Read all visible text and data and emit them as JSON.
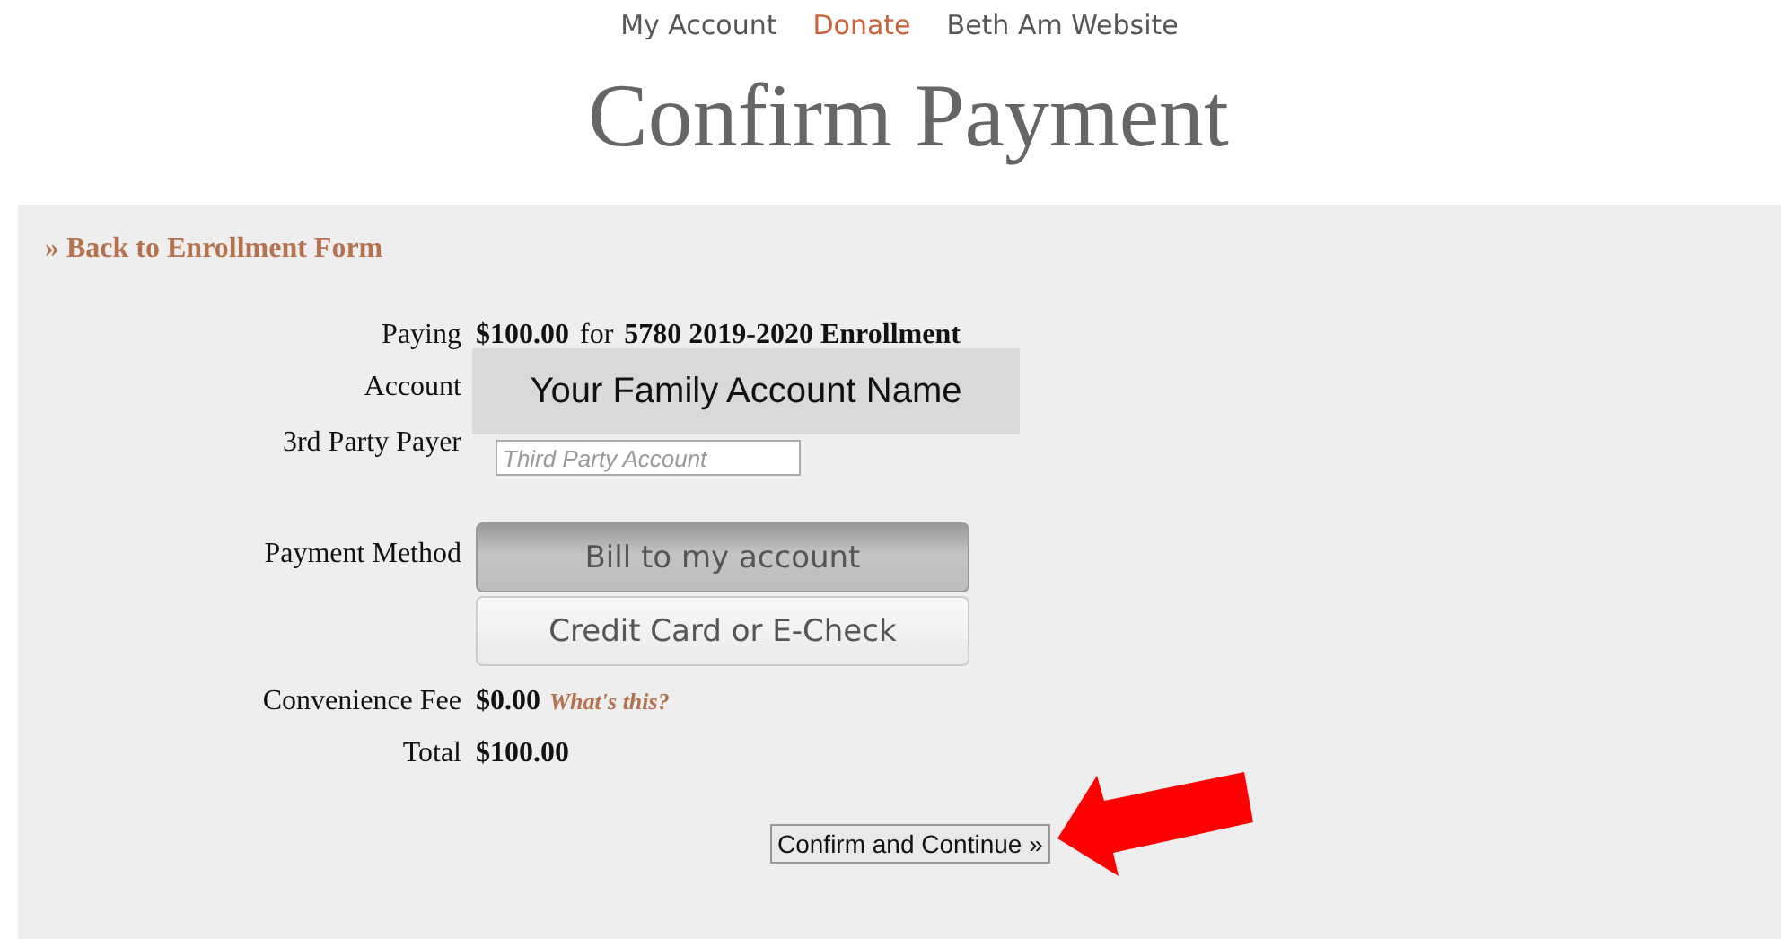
{
  "nav": [
    {
      "label": "My Account",
      "highlighted": false
    },
    {
      "label": "Donate",
      "highlighted": true
    },
    {
      "label": "Beth Am Website",
      "highlighted": false
    }
  ],
  "title": "Confirm Payment",
  "back_link": "» Back to Enrollment Form",
  "paying": {
    "label": "Paying",
    "amount": "$100.00",
    "for": "for",
    "item": "5780 2019-2020 Enrollment"
  },
  "account": {
    "label": "Account",
    "value": "Your Family Account Name"
  },
  "third_party": {
    "label": "3rd Party Payer",
    "placeholder": "Third Party Account"
  },
  "payment_method": {
    "label": "Payment Method",
    "options": [
      {
        "label": "Bill to my account",
        "selected": true
      },
      {
        "label": "Credit Card or E-Check",
        "selected": false
      }
    ]
  },
  "fee": {
    "label": "Convenience Fee",
    "value": "$0.00",
    "link": "What's this?"
  },
  "total": {
    "label": "Total",
    "value": "$100.00"
  },
  "confirm_button": "Confirm and Continue »"
}
